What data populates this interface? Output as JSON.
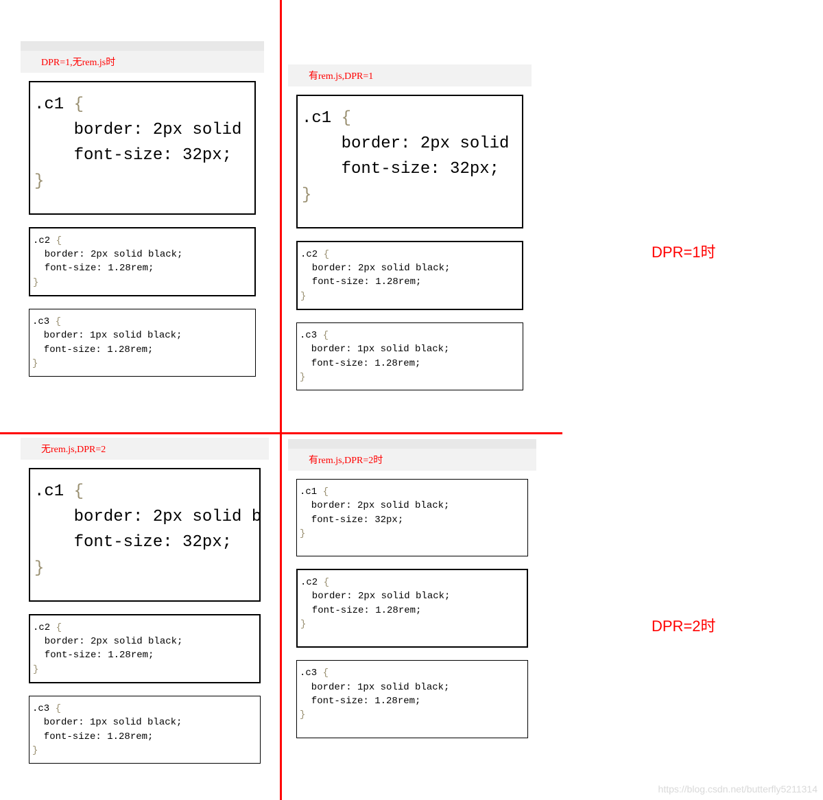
{
  "side_labels": {
    "top": "DPR=1时",
    "bottom": "DPR=2时"
  },
  "quadrants": {
    "tl": {
      "title": "DPR=1,无rem.js时",
      "boxes": [
        {
          "cls": "large",
          "sel": ".c1",
          "l1": "    border: 2px solid",
          "l2": "    font-size: 32px;"
        },
        {
          "cls": "medium",
          "sel": ".c2",
          "l1": "  border: 2px solid black;",
          "l2": "  font-size: 1.28rem;"
        },
        {
          "cls": "medium thin",
          "sel": ".c3",
          "l1": "  border: 1px solid black;",
          "l2": "  font-size: 1.28rem;"
        }
      ]
    },
    "tr": {
      "title": "有rem.js,DPR=1",
      "boxes": [
        {
          "cls": "large",
          "sel": ".c1",
          "l1": "    border: 2px solid",
          "l2": "    font-size: 32px;"
        },
        {
          "cls": "medium",
          "sel": ".c2",
          "l1": "  border: 2px solid black;",
          "l2": "  font-size: 1.28rem;"
        },
        {
          "cls": "medium thin",
          "sel": ".c3",
          "l1": "  border: 1px solid black;",
          "l2": "  font-size: 1.28rem;"
        }
      ]
    },
    "bl": {
      "title": "无rem.js,DPR=2",
      "boxes": [
        {
          "cls": "large",
          "sel": ".c1",
          "l1": "    border: 2px solid b",
          "l2": "    font-size: 32px;"
        },
        {
          "cls": "medium",
          "sel": ".c2",
          "l1": "  border: 2px solid black;",
          "l2": "  font-size: 1.28rem;"
        },
        {
          "cls": "medium thin",
          "sel": ".c3",
          "l1": "  border: 1px solid black;",
          "l2": "  font-size: 1.28rem;"
        }
      ]
    },
    "br": {
      "title": "有rem.js,DPR=2时",
      "boxes": [
        {
          "cls": "medium thin",
          "sel": ".c1",
          "l1": "  border: 2px solid black;",
          "l2": "  font-size: 32px;"
        },
        {
          "cls": "medium",
          "sel": ".c2",
          "l1": "  border: 2px solid black;",
          "l2": "  font-size: 1.28rem;"
        },
        {
          "cls": "medium thin",
          "sel": ".c3",
          "l1": "  border: 1px solid black;",
          "l2": "  font-size: 1.28rem;"
        }
      ]
    }
  },
  "watermark": "https://blog.csdn.net/butterfly5211314"
}
